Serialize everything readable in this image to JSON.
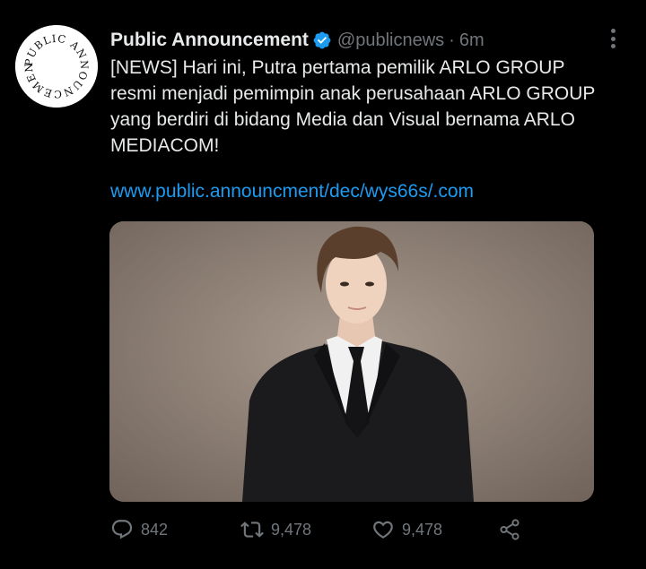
{
  "tweet": {
    "avatar_text": "PUBLIC ANNOUNCEMENT",
    "display_name": "Public Announcement",
    "handle": "@publicnews",
    "separator": "·",
    "time": "6m",
    "text": "[NEWS] Hari ini, Putra pertama pemilik ARLO GROUP resmi menjadi pemimpin anak perusahaan ARLO GROUP yang berdiri di bidang Media dan Visual bernama ARLO MEDIACOM!",
    "link": "www.public.announcment/dec/wys66s/.com",
    "actions": {
      "replies": "842",
      "retweets": "9,478",
      "likes": "9,478"
    }
  },
  "colors": {
    "background": "#000000",
    "text": "#e7e9ea",
    "secondary": "#71767b",
    "link": "#1d9bf0",
    "verified": "#1d9bf0"
  },
  "icons": [
    "vertical-dots-icon",
    "verified-badge-icon",
    "reply-icon",
    "retweet-icon",
    "like-icon",
    "share-icon"
  ]
}
